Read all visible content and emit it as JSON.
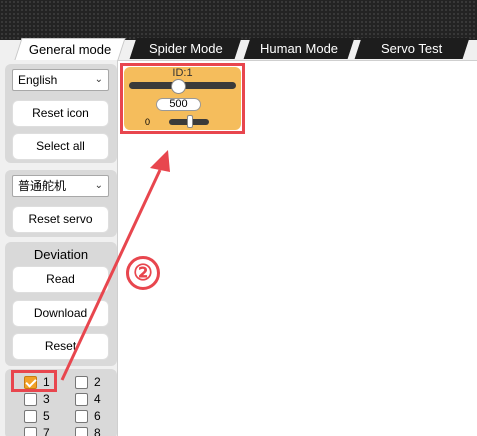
{
  "tabs": [
    "General mode",
    "Spider Mode",
    "Human Mode",
    "Servo Test"
  ],
  "sidebar": {
    "language_select": "English",
    "reset_icon": "Reset icon",
    "select_all": "Select all",
    "servo_type_select": "普通舵机",
    "reset_servo": "Reset servo",
    "deviation": {
      "title": "Deviation",
      "read": "Read",
      "download": "Download",
      "reset": "Reset"
    },
    "servo_checkboxes": [
      {
        "label": "1",
        "checked": true
      },
      {
        "label": "2",
        "checked": false
      },
      {
        "label": "3",
        "checked": false
      },
      {
        "label": "4",
        "checked": false
      },
      {
        "label": "5",
        "checked": false
      },
      {
        "label": "6",
        "checked": false
      },
      {
        "label": "7",
        "checked": false
      },
      {
        "label": "8",
        "checked": false
      }
    ]
  },
  "servo_widget": {
    "id_label": "ID:1",
    "value": "500",
    "small_label": "0"
  },
  "annotation": {
    "step_number": "②",
    "color": "#e8464e"
  },
  "colors": {
    "widget_bg": "#f5bd5c",
    "checkbox_checked": "#f2a127"
  }
}
